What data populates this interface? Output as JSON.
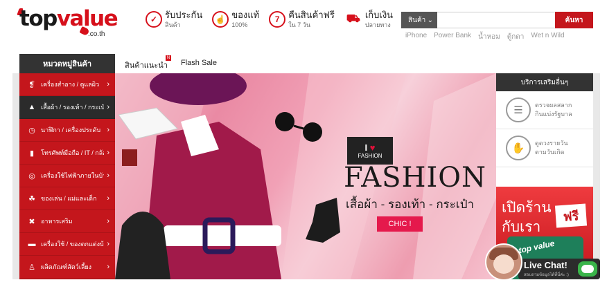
{
  "brand": {
    "name_top": "top",
    "name_value": "value",
    "domain": ".co.th"
  },
  "features": [
    {
      "icon": "shield-icon",
      "glyph": "✓",
      "title": "รับประกัน",
      "sub": "สินค้า"
    },
    {
      "icon": "thumbs-up-icon",
      "glyph": "☝",
      "title": "ของแท้",
      "sub": "100%"
    },
    {
      "icon": "return-7-icon",
      "glyph": "7",
      "title": "คืนสินค้าฟรี",
      "sub": "ใน 7 วัน"
    },
    {
      "icon": "truck-icon",
      "glyph": "⛟",
      "title": "เก็บเงิน",
      "sub": "ปลายทาง"
    }
  ],
  "search": {
    "category": "สินค้า",
    "placeholder": "",
    "button": "ค้นหา"
  },
  "keywords": [
    "iPhone",
    "Power Bank",
    "น้ำหอม",
    "ตู้กดา",
    "Wet n Wild"
  ],
  "nav": {
    "category_label": "หมวดหมู่สินค้า",
    "recommended": "สินค้าแนะนำ",
    "recommended_badge": "N",
    "flash_sale": "Flash Sale"
  },
  "sidebar": [
    {
      "icon": "lipstick-icon",
      "glyph": "❡",
      "label": "เครื่องสำอาง / ดูแลผิว",
      "active": false
    },
    {
      "icon": "dress-icon",
      "glyph": "▲",
      "label": "เสื้อผ้า / รองเท้า / กระเป๋า",
      "active": true
    },
    {
      "icon": "watch-icon",
      "glyph": "◷",
      "label": "นาฬิกา / เครื่องประดับ",
      "active": false
    },
    {
      "icon": "phone-icon",
      "glyph": "▮",
      "label": "โทรศัพท์มือถือ / IT / กล้อง",
      "active": false
    },
    {
      "icon": "washing-machine-icon",
      "glyph": "◎",
      "label": "เครื่องใช้ไฟฟ้าภายในบ้าน",
      "active": false
    },
    {
      "icon": "stroller-icon",
      "glyph": "☘",
      "label": "ของเล่น / แม่และเด็ก",
      "active": false
    },
    {
      "icon": "pill-icon",
      "glyph": "✖",
      "label": "อาหารเสริม",
      "active": false
    },
    {
      "icon": "sofa-icon",
      "glyph": "▬",
      "label": "เครื่องใช้ / ของตกแต่งบ้าน",
      "active": false
    },
    {
      "icon": "dog-icon",
      "glyph": "♙",
      "label": "ผลิตภัณฑ์สัตว์เลี้ยง",
      "active": false
    }
  ],
  "banner": {
    "i_label": "I",
    "heart": "♥",
    "fashion_small": "FASHION",
    "title": "FASHION",
    "subtitle": "เสื้อผ้า - รองเท้า - กระเป๋า",
    "cta": "CHIC !"
  },
  "services": {
    "title": "บริการเสริมอื่นๆ",
    "items": [
      {
        "icon": "ticket-icon",
        "glyph": "☰",
        "line1": "ตรวจผลสลาก",
        "line2": "กินแบ่งรัฐบาล"
      },
      {
        "icon": "palm-icon",
        "glyph": "✋",
        "line1": "ดูดวงรายวัน",
        "line2": "ตามวันเกิด"
      }
    ],
    "promo": {
      "line1": "เปิดร้าน",
      "line2": "กับเรา",
      "free": "ฟรี",
      "bag_logo": "top value"
    }
  },
  "livechat": {
    "title": "Live Chat!",
    "sub": "สอบถามข้อมูลได้ที่นี่ค่ะ :)"
  },
  "colors": {
    "accent": "#c4161c",
    "dark": "#333333",
    "banner_pink": "#ea8aa4"
  }
}
